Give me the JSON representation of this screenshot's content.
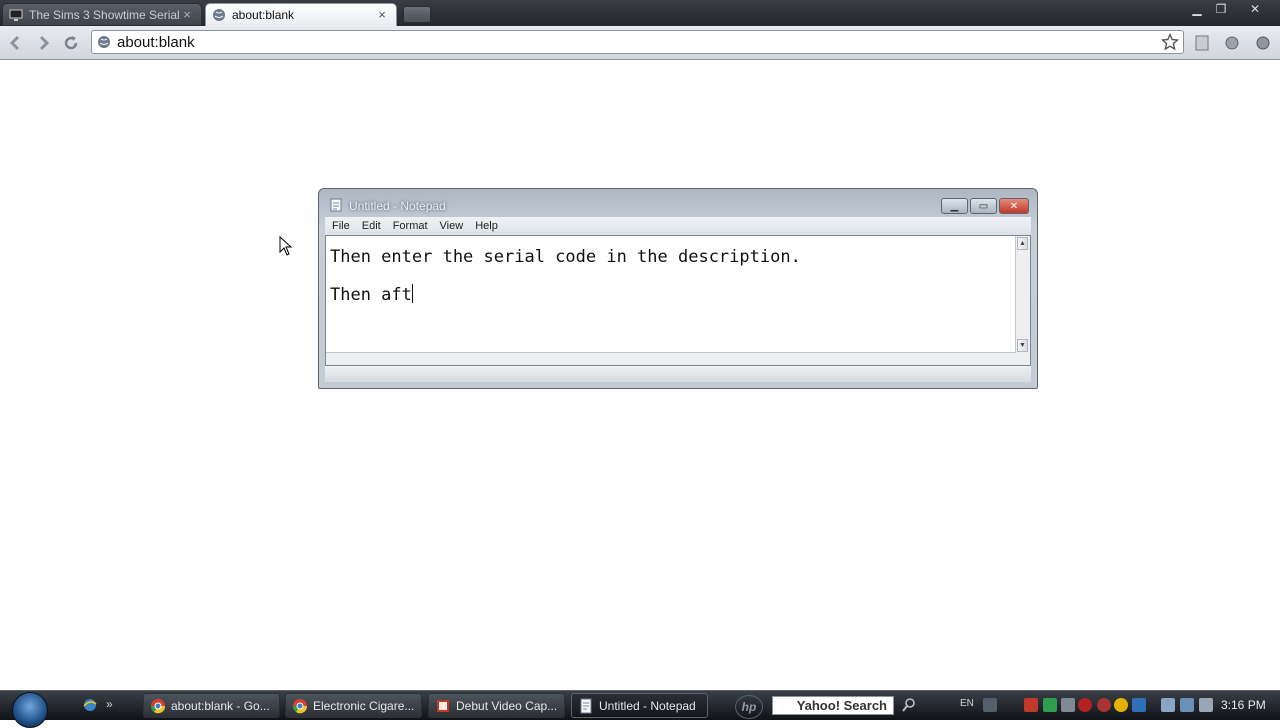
{
  "browser": {
    "tabs": [
      {
        "title": "The Sims 3 Showtime Serial...",
        "active": false
      },
      {
        "title": "about:blank",
        "active": true
      }
    ],
    "address_bar_value": "about:blank"
  },
  "notepad": {
    "window_title": "Untitled - Notepad",
    "menu": [
      "File",
      "Edit",
      "Format",
      "View",
      "Help"
    ],
    "text_lines": [
      "Then enter the serial code in the description.",
      "Then aft"
    ]
  },
  "taskbar": {
    "tasks": [
      {
        "label": "about:blank - Go...",
        "icon": "chrome-icon",
        "active": false
      },
      {
        "label": "Electronic Cigare...",
        "icon": "chrome-icon",
        "active": false
      },
      {
        "label": "Debut Video Cap...",
        "icon": "debut-icon",
        "active": false
      },
      {
        "label": "Untitled - Notepad",
        "icon": "notepad-icon",
        "active": true
      }
    ],
    "search_text": "Yahoo! Search",
    "language": "EN",
    "clock": "3:16 PM"
  },
  "colors": {
    "tab_strip": "#2b2e33",
    "toolbar": "#dde1e7",
    "taskbar": "#1c1f24",
    "notepad_close": "#c0392b"
  }
}
